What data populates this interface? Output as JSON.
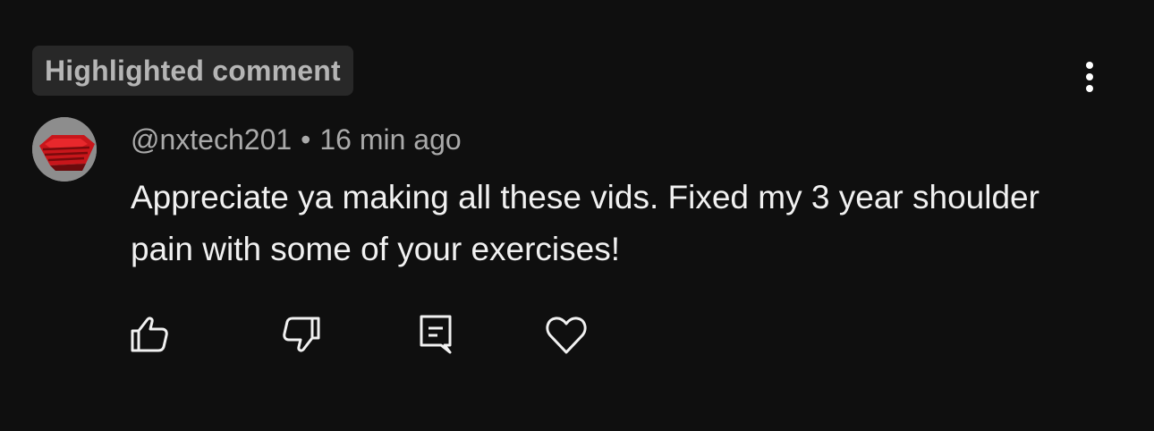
{
  "badge": {
    "label": "Highlighted comment"
  },
  "comment": {
    "author": "@nxtech201",
    "separator": "•",
    "time": "16 min ago",
    "text": "Appreciate ya making all these vids. Fixed my 3 year shoulder pain with some of your exercises!"
  },
  "actions": {
    "like_icon": "thumbs-up-icon",
    "dislike_icon": "thumbs-down-icon",
    "reply_icon": "reply-comment-icon",
    "heart_icon": "heart-icon",
    "menu_icon": "more-vertical-icon"
  },
  "colors": {
    "background": "#0f0f0f",
    "badge_bg": "#282828",
    "badge_text": "#b5b5b5",
    "meta_text": "#aaaaaa",
    "body_text": "#f1f1f1",
    "avatar_red": "#c8161b"
  }
}
